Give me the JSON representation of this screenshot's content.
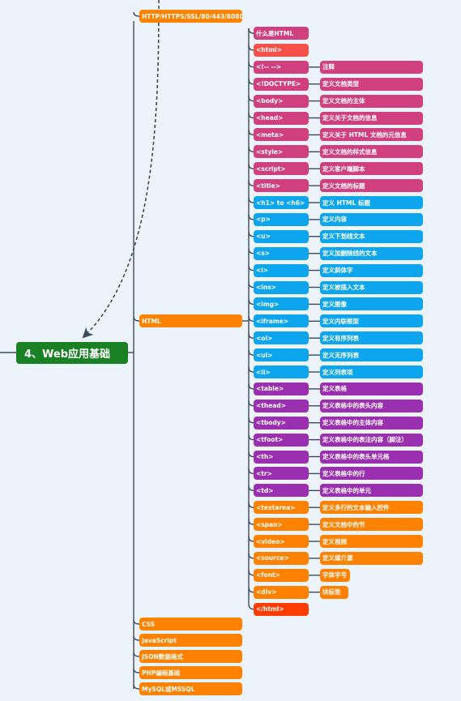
{
  "colors": {
    "background": "#edf3fa",
    "root": "#1a8024",
    "branch": "#ff8100",
    "pink": "#d0407f",
    "red": "#f5504a",
    "blue": "#0ea5ef",
    "purple": "#9a2fb0",
    "orange": "#ff8100",
    "dark_red": "#ff3d00",
    "line": "#3c4a5c"
  },
  "root": {
    "label": "4、Web应用基础"
  },
  "branches": [
    {
      "label": "HTTP/HTTPS/SSL/80/443/8080"
    },
    {
      "label": "HTML"
    },
    {
      "label": "CSS"
    },
    {
      "label": "JavaScript"
    },
    {
      "label": "JSON数据格式"
    },
    {
      "label": "PHP编程基础"
    },
    {
      "label": "MySQL或MSSQL"
    }
  ],
  "html_items": [
    {
      "tag": "什么是HTML",
      "desc": null,
      "color": "pink"
    },
    {
      "tag": "<html>",
      "desc": null,
      "color": "red"
    },
    {
      "tag": "<!-- -->",
      "desc": "注释",
      "color": "pink"
    },
    {
      "tag": "<!DOCTYPE>",
      "desc": "定义文档类型",
      "color": "pink"
    },
    {
      "tag": "<body>",
      "desc": "定义文档的主体",
      "color": "pink"
    },
    {
      "tag": "<head>",
      "desc": "定义关于文档的信息",
      "color": "pink"
    },
    {
      "tag": "<meta>",
      "desc": "定义关于 HTML 文档的元信息",
      "color": "pink"
    },
    {
      "tag": "<style>",
      "desc": "定义文档的样式信息",
      "color": "pink"
    },
    {
      "tag": "<script>",
      "desc": "定义客户端脚本",
      "color": "pink"
    },
    {
      "tag": "<title>",
      "desc": "定义文档的标题",
      "color": "pink"
    },
    {
      "tag": "<h1> to <h6>",
      "desc": "定义 HTML 标题",
      "color": "blue"
    },
    {
      "tag": "<p>",
      "desc": "定义内容",
      "color": "blue"
    },
    {
      "tag": "<u>",
      "desc": "定义下划线文本",
      "color": "blue"
    },
    {
      "tag": "<s>",
      "desc": "定义加删除线的文本",
      "color": "blue"
    },
    {
      "tag": "<i>",
      "desc": "定义斜体字",
      "color": "blue"
    },
    {
      "tag": "<ins>",
      "desc": "定义被插入文本",
      "color": "blue"
    },
    {
      "tag": "<img>",
      "desc": "定义图像",
      "color": "blue"
    },
    {
      "tag": "<iframe>",
      "desc": "定义内联框架",
      "color": "blue"
    },
    {
      "tag": "<ol>",
      "desc": "定义有序列表",
      "color": "blue"
    },
    {
      "tag": "<ul>",
      "desc": "定义无序列表",
      "color": "blue"
    },
    {
      "tag": "<li>",
      "desc": "定义列表项",
      "color": "blue"
    },
    {
      "tag": "<table>",
      "desc": "定义表格",
      "color": "purple"
    },
    {
      "tag": "<thead>",
      "desc": "定义表格中的表头内容",
      "color": "purple"
    },
    {
      "tag": "<tbody>",
      "desc": "定义表格中的主体内容",
      "color": "purple"
    },
    {
      "tag": "<tfoot>",
      "desc": "定义表格中的表注内容（脚注）",
      "color": "purple"
    },
    {
      "tag": "<th>",
      "desc": "定义表格中的表头单元格",
      "color": "purple"
    },
    {
      "tag": "<tr>",
      "desc": "定义表格中的行",
      "color": "purple"
    },
    {
      "tag": "<td>",
      "desc": "定义表格中的单元",
      "color": "purple"
    },
    {
      "tag": "<textarea>",
      "desc": "定义多行的文本输入控件",
      "color": "orange"
    },
    {
      "tag": "<span>",
      "desc": "定义文档中的节",
      "color": "orange"
    },
    {
      "tag": "<video>",
      "desc": "定义视频",
      "color": "orange"
    },
    {
      "tag": "<source>",
      "desc": "定义媒介源",
      "color": "orange"
    },
    {
      "tag": "<font>",
      "desc": "字体字号",
      "color": "orange",
      "short": true
    },
    {
      "tag": "<div>",
      "desc": "块标签",
      "color": "orange",
      "short": true
    },
    {
      "tag": "</html>",
      "desc": null,
      "color": "dark_red"
    }
  ]
}
